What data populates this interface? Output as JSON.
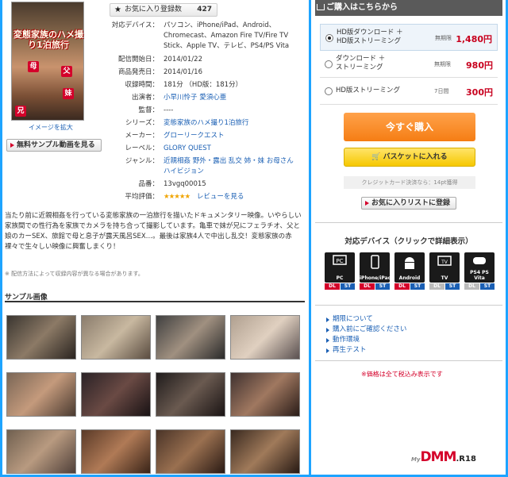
{
  "cover": {
    "title": "変態家族のハメ撮り1泊旅行",
    "tags": [
      "母",
      "父",
      "妹",
      "兄"
    ],
    "enlarge_label": "イメージを拡大"
  },
  "sample_video_label": "無料サンプル動画を見る",
  "favorites": {
    "label": "お気に入り登録数",
    "count": "427"
  },
  "info": [
    {
      "key": "対応デバイス：",
      "value": "パソコン、iPhone/iPad、Android、Chromecast、Amazon Fire TV/Fire TV Stick、Apple TV、テレビ、PS4/PS Vita",
      "link": false
    },
    {
      "key": "配信開始日：",
      "value": "2014/01/22",
      "link": false
    },
    {
      "key": "商品発売日：",
      "value": "2014/01/16",
      "link": false
    },
    {
      "key": "収録時間：",
      "value": "181分 （HD版：181分）",
      "link": false
    },
    {
      "key": "出演者：",
      "value": "小早川怜子 愛須心亜",
      "link": true
    },
    {
      "key": "監督：",
      "value": "----",
      "link": false
    },
    {
      "key": "シリーズ：",
      "value": "変態家族のハメ撮り1泊旅行",
      "link": true
    },
    {
      "key": "メーカー：",
      "value": "グローリークエスト",
      "link": true
    },
    {
      "key": "レーベル：",
      "value": "GLORY QUEST",
      "link": true
    },
    {
      "key": "ジャンル：",
      "value": "近親相姦 野外・露出 乱交 姉・妹 お母さん ハイビジョン",
      "link": true
    },
    {
      "key": "品番：",
      "value": "13vgq00015",
      "link": false
    }
  ],
  "rating": {
    "key": "平均評価：",
    "stars": "★★★★★",
    "review_link": "レビューを見る"
  },
  "description": "当たり前に近親相姦を行っている変態家族の一泊旅行を描いたドキュメンタリー映像。いやらしい家族間での性行為を家族でカメラを持ち合って撮影しています。亀車で妹が兄にフェラチオ、父と娘のカーSEX、旅館で母と息子が露天風呂SEX…。最後は家族4人で中出し乱交！変態家族の赤裸々で生々しい映像に興奮しまくり！",
  "note": "※ 配信方法によって収録内容が異なる場合があります。",
  "sample_images_heading": "サンプル画像",
  "purchase": {
    "heading": "ご購入はこちらから",
    "options": [
      {
        "label_1": "HD版ダウンロード ＋",
        "label_2": "HD版ストリーミング",
        "kind": "無期限",
        "price": "1,480円",
        "selected": true
      },
      {
        "label_1": "ダウンロード ＋",
        "label_2": "ストリーミング",
        "kind": "無期限",
        "price": "980円",
        "selected": false
      },
      {
        "label_1": "HD版ストリーミング",
        "label_2": "",
        "kind": "7日間",
        "price": "300円",
        "selected": false
      }
    ],
    "buy_now": "今すぐ購入",
    "basket": "バスケットに入れる",
    "credit_note": "クレジットカード決済なら：14pt獲得",
    "add_fav": "お気に入りリストに登録"
  },
  "devices": {
    "title": "対応デバイス（クリックで詳細表示）",
    "items": [
      {
        "name": "PC",
        "dl": "DL",
        "st": "ST",
        "dl_on": true,
        "st_on": true
      },
      {
        "name": "iPhone/iPad",
        "dl": "DL",
        "st": "ST",
        "dl_on": true,
        "st_on": true
      },
      {
        "name": "Android",
        "dl": "DL",
        "st": "ST",
        "dl_on": true,
        "st_on": true
      },
      {
        "name": "TV",
        "dl": "DL",
        "st": "ST",
        "dl_on": false,
        "st_on": true
      },
      {
        "name": "PS4 PS Vita",
        "dl": "DL",
        "st": "ST",
        "dl_on": false,
        "st_on": true
      }
    ]
  },
  "links": [
    "期限について",
    "購入前にご確認ください",
    "動作環境",
    "再生テスト"
  ],
  "tax_note": "※価格は全て税込み表示です",
  "logo": {
    "my": "My",
    "dmm": "DMM",
    "r18": ".R18"
  },
  "colors": {
    "accent": "#1ea4ff",
    "price": "#c8001e",
    "buy": "#f57d14",
    "basket": "#f6c800"
  }
}
